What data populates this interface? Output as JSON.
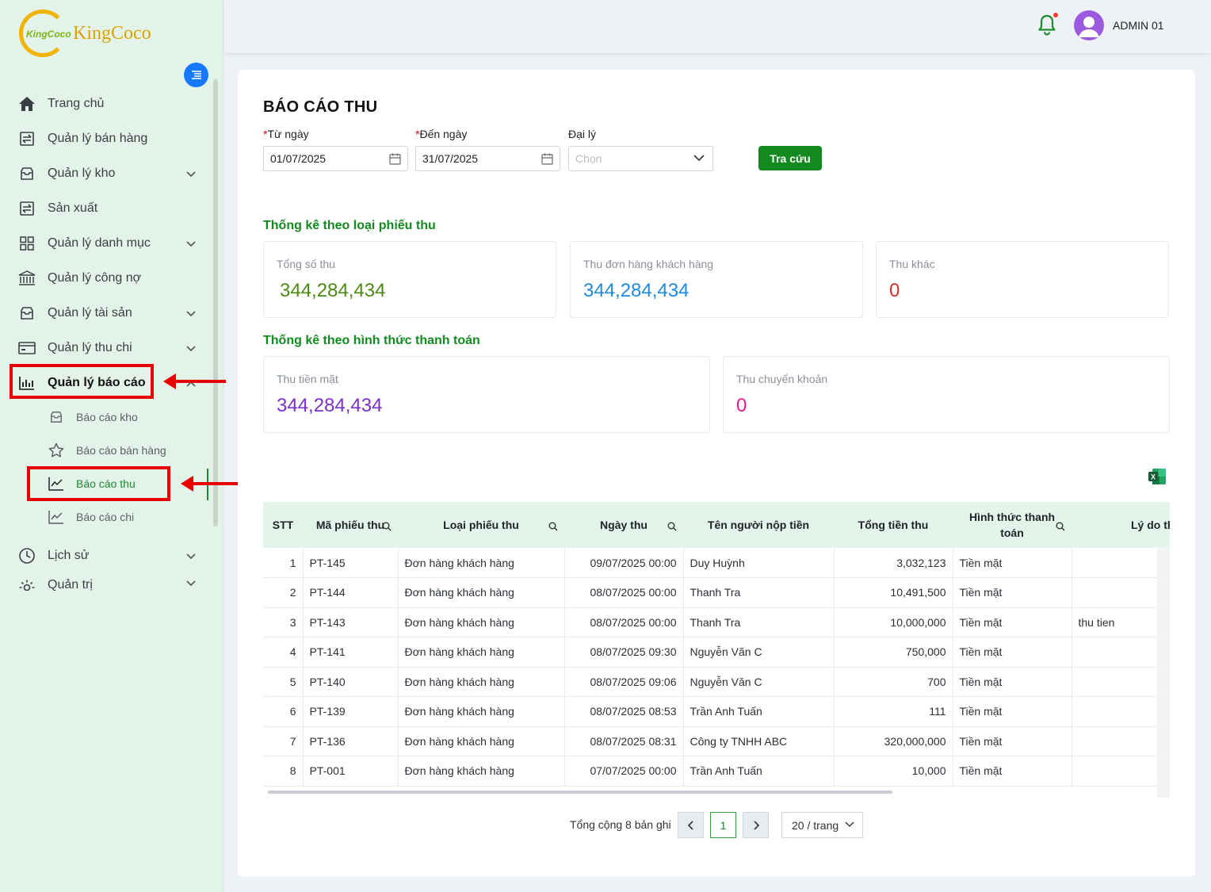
{
  "brand": {
    "name": "KingCoco",
    "mark_text": "KingCoco"
  },
  "header": {
    "username": "ADMIN 01"
  },
  "sidebar": {
    "items": [
      {
        "label": "Trang chủ",
        "icon": "home-icon",
        "has_chevron": false
      },
      {
        "label": "Quản lý bán hàng",
        "icon": "sales-icon",
        "has_chevron": false
      },
      {
        "label": "Quản lý kho",
        "icon": "warehouse-icon",
        "has_chevron": true
      },
      {
        "label": "Sản xuất",
        "icon": "production-icon",
        "has_chevron": false
      },
      {
        "label": "Quản lý danh mục",
        "icon": "grid-icon",
        "has_chevron": true
      },
      {
        "label": "Quản lý công nợ",
        "icon": "bank-icon",
        "has_chevron": false
      },
      {
        "label": "Quản lý tài sản",
        "icon": "asset-icon",
        "has_chevron": true
      },
      {
        "label": "Quản lý thu chi",
        "icon": "wallet-icon",
        "has_chevron": true
      },
      {
        "label": "Quản lý báo cáo",
        "icon": "bar-chart-icon",
        "has_chevron": true
      }
    ],
    "report_sub": [
      {
        "label": "Báo cáo kho",
        "icon": "box-icon"
      },
      {
        "label": "Báo cáo bán hàng",
        "icon": "star-icon"
      },
      {
        "label": "Báo cáo thu",
        "icon": "line-chart-icon"
      },
      {
        "label": "Báo cáo chi",
        "icon": "line-chart-icon"
      }
    ],
    "bottom_items": [
      {
        "label": "Lịch sử",
        "icon": "clock-icon"
      },
      {
        "label": "Quản trị",
        "icon": "settings-icon"
      }
    ]
  },
  "page": {
    "title": "BÁO CÁO THU"
  },
  "filters": {
    "from_label": "Từ ngày",
    "from_value": "01/07/2025",
    "to_label": "Đến ngày",
    "to_value": "31/07/2025",
    "agent_label": "Đại lý",
    "agent_placeholder": "Chọn",
    "search_button": "Tra cứu"
  },
  "stats_by_type": {
    "title": "Thống kê theo loại phiếu thu",
    "cards": [
      {
        "label": "Tổng số thu",
        "value": "344,284,434",
        "color": "#4d8a12"
      },
      {
        "label": "Thu đơn hàng khách hàng",
        "value": "344,284,434",
        "color": "#1e88e5"
      },
      {
        "label": "Thu khác",
        "value": "0",
        "color": "#d32f2f"
      }
    ]
  },
  "stats_by_payment": {
    "title": "Thống kê theo hình thức thanh toán",
    "cards": [
      {
        "label": "Thu tiền mặt",
        "value": "344,284,434",
        "color": "#7b2fc9"
      },
      {
        "label": "Thu chuyển khoản",
        "value": "0",
        "color": "#e91e8c"
      }
    ]
  },
  "table": {
    "columns": [
      "STT",
      "Mã phiếu thu",
      "Loại phiếu thu",
      "Ngày thu",
      "Tên người nộp tiền",
      "Tổng tiền thu",
      "Hình thức thanh toán",
      "Lý do thu"
    ],
    "rows": [
      [
        "1",
        "PT-145",
        "Đơn hàng khách hàng",
        "09/07/2025 00:00",
        "Duy Huỳnh",
        "3,032,123",
        "Tiền mặt",
        ""
      ],
      [
        "2",
        "PT-144",
        "Đơn hàng khách hàng",
        "08/07/2025 00:00",
        "Thanh Tra",
        "10,491,500",
        "Tiền mặt",
        ""
      ],
      [
        "3",
        "PT-143",
        "Đơn hàng khách hàng",
        "08/07/2025 00:00",
        "Thanh Tra",
        "10,000,000",
        "Tiền mặt",
        "thu tien"
      ],
      [
        "4",
        "PT-141",
        "Đơn hàng khách hàng",
        "08/07/2025 09:30",
        "Nguyễn Văn C",
        "750,000",
        "Tiền mặt",
        ""
      ],
      [
        "5",
        "PT-140",
        "Đơn hàng khách hàng",
        "08/07/2025 09:06",
        "Nguyễn Văn C",
        "700",
        "Tiền mặt",
        ""
      ],
      [
        "6",
        "PT-139",
        "Đơn hàng khách hàng",
        "08/07/2025 08:53",
        "Trần Anh Tuấn",
        "111",
        "Tiền mặt",
        ""
      ],
      [
        "7",
        "PT-136",
        "Đơn hàng khách hàng",
        "08/07/2025 08:31",
        "Công ty TNHH ABC",
        "320,000,000",
        "Tiền mặt",
        ""
      ],
      [
        "8",
        "PT-001",
        "Đơn hàng khách hàng",
        "07/07/2025 00:00",
        "Trần Anh Tuấn",
        "10,000",
        "Tiền mặt",
        ""
      ]
    ]
  },
  "pagination": {
    "total_text": "Tổng cộng 8 bản ghi",
    "current_page": "1",
    "page_size": "20 / trang"
  },
  "colors": {
    "accent": "#138a1f",
    "sidebar_bg": "#e4f3ea",
    "annotation": "#e60000"
  }
}
